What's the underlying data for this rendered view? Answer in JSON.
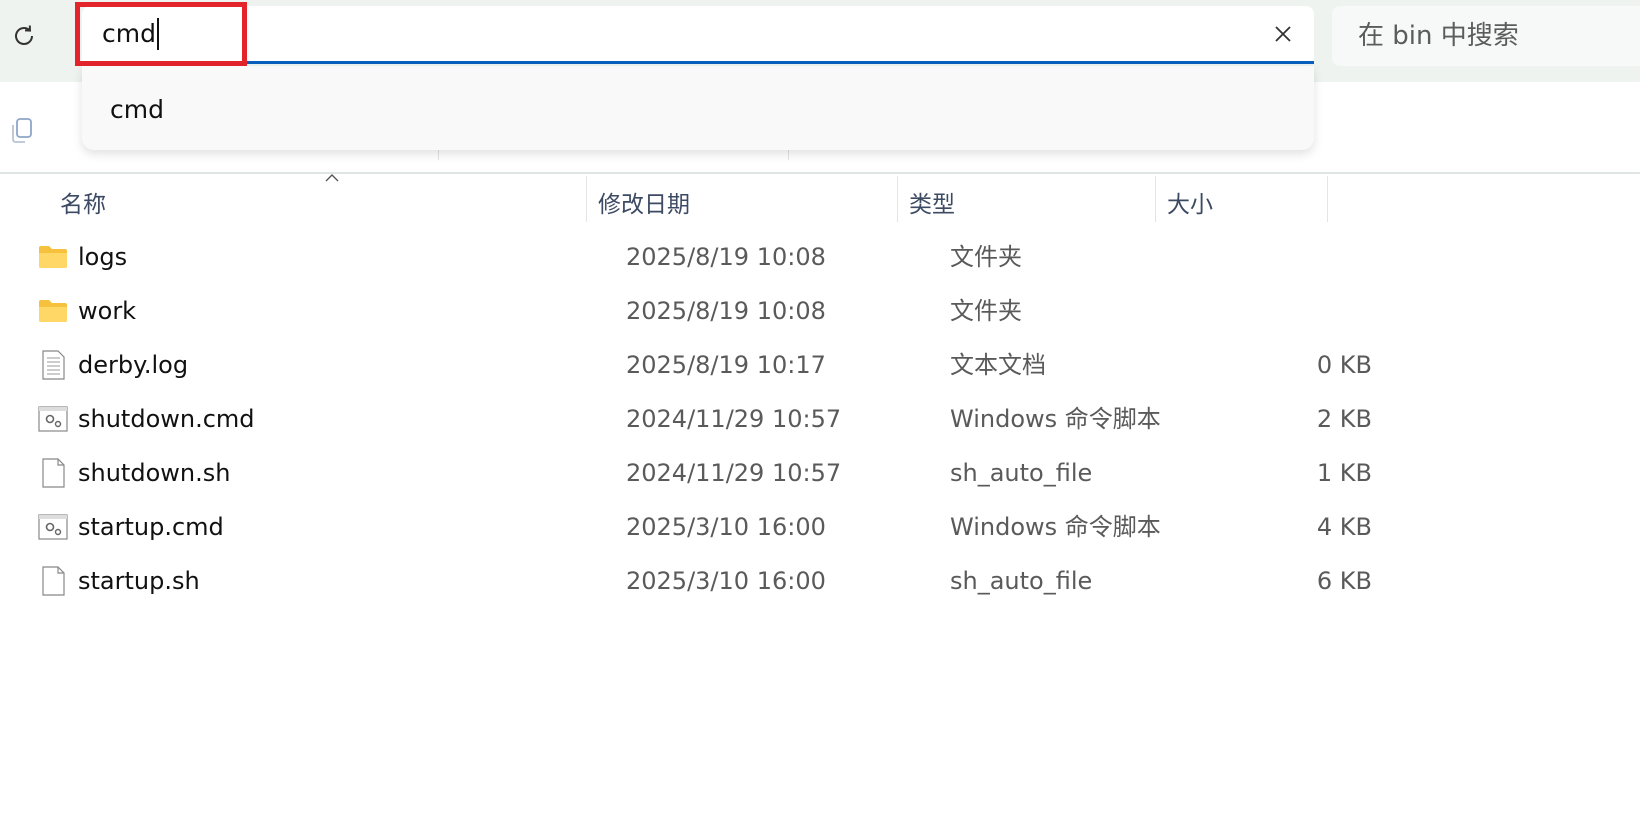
{
  "address": {
    "value": "cmd"
  },
  "search": {
    "placeholder": "在 bin 中搜索"
  },
  "suggestions": [
    "cmd"
  ],
  "columns": {
    "name": "名称",
    "modified": "修改日期",
    "type": "类型",
    "size": "大小"
  },
  "files": [
    {
      "icon": "folder-icon",
      "name": "logs",
      "modified": "2025/8/19 10:08",
      "type": "文件夹",
      "size": ""
    },
    {
      "icon": "folder-icon",
      "name": "work",
      "modified": "2025/8/19 10:08",
      "type": "文件夹",
      "size": ""
    },
    {
      "icon": "text-document-icon",
      "name": "derby.log",
      "modified": "2025/8/19 10:17",
      "type": "文本文档",
      "size": "0 KB"
    },
    {
      "icon": "script-gear-icon",
      "name": "shutdown.cmd",
      "modified": "2024/11/29 10:57",
      "type": "Windows 命令脚本",
      "size": "2 KB"
    },
    {
      "icon": "blank-file-icon",
      "name": "shutdown.sh",
      "modified": "2024/11/29 10:57",
      "type": "sh_auto_file",
      "size": "1 KB"
    },
    {
      "icon": "script-gear-icon",
      "name": "startup.cmd",
      "modified": "2025/3/10 16:00",
      "type": "Windows 命令脚本",
      "size": "4 KB"
    },
    {
      "icon": "blank-file-icon",
      "name": "startup.sh",
      "modified": "2025/3/10 16:00",
      "type": "sh_auto_file",
      "size": "6 KB"
    }
  ],
  "colors": {
    "accent": "#0a5fbf",
    "highlight": "#e3242b",
    "folder": "#f6c23d"
  }
}
